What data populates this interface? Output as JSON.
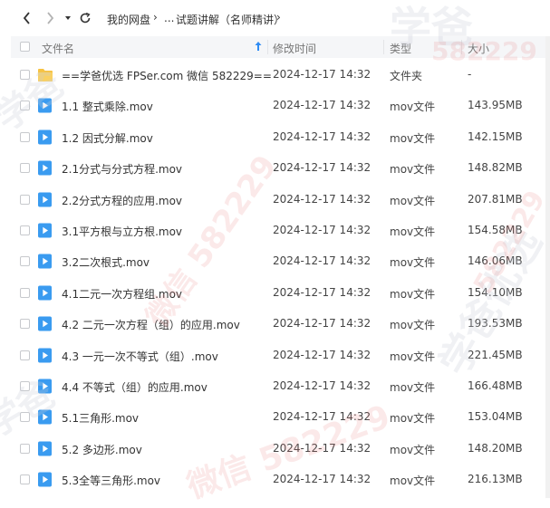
{
  "breadcrumb": {
    "root": "我的网盘",
    "ellipsis": "...",
    "current": "试题讲解（名师精讲）"
  },
  "icons": {
    "back": "chevron-left-icon",
    "forward": "chevron-right-icon",
    "history": "caret-down-icon",
    "refresh": "refresh-icon",
    "sort": "sort-ascending-icon",
    "folder": "folder-icon",
    "video": "video-file-icon"
  },
  "columns": {
    "name": "文件名",
    "modified": "修改时间",
    "type": "类型",
    "size": "大小"
  },
  "files": [
    {
      "name": "==学爸优选 FPSer.com 微信 582229==",
      "modified": "2024-12-17 14:32",
      "type": "文件夹",
      "size": "-",
      "kind": "folder"
    },
    {
      "name": "1.1 整式乘除.mov",
      "modified": "2024-12-17 14:32",
      "type": "mov文件",
      "size": "143.95MB",
      "kind": "video"
    },
    {
      "name": "1.2 因式分解.mov",
      "modified": "2024-12-17 14:32",
      "type": "mov文件",
      "size": "142.15MB",
      "kind": "video"
    },
    {
      "name": "2.1分式与分式方程.mov",
      "modified": "2024-12-17 14:32",
      "type": "mov文件",
      "size": "148.82MB",
      "kind": "video"
    },
    {
      "name": "2.2分式方程的应用.mov",
      "modified": "2024-12-17 14:32",
      "type": "mov文件",
      "size": "207.81MB",
      "kind": "video"
    },
    {
      "name": "3.1平方根与立方根.mov",
      "modified": "2024-12-17 14:32",
      "type": "mov文件",
      "size": "154.58MB",
      "kind": "video"
    },
    {
      "name": "3.2二次根式.mov",
      "modified": "2024-12-17 14:32",
      "type": "mov文件",
      "size": "146.06MB",
      "kind": "video"
    },
    {
      "name": "4.1二元一次方程组.mov",
      "modified": "2024-12-17 14:32",
      "type": "mov文件",
      "size": "154.10MB",
      "kind": "video"
    },
    {
      "name": "4.2 二元一次方程（组）的应用.mov",
      "modified": "2024-12-17 14:32",
      "type": "mov文件",
      "size": "193.53MB",
      "kind": "video"
    },
    {
      "name": "4.3 一元一次不等式（组）.mov",
      "modified": "2024-12-17 14:32",
      "type": "mov文件",
      "size": "221.45MB",
      "kind": "video"
    },
    {
      "name": "4.4 不等式（组）的应用.mov",
      "modified": "2024-12-17 14:32",
      "type": "mov文件",
      "size": "166.48MB",
      "kind": "video"
    },
    {
      "name": "5.1三角形.mov",
      "modified": "2024-12-17 14:32",
      "type": "mov文件",
      "size": "153.04MB",
      "kind": "video"
    },
    {
      "name": "5.2 多边形.mov",
      "modified": "2024-12-17 14:32",
      "type": "mov文件",
      "size": "148.20MB",
      "kind": "video"
    },
    {
      "name": "5.3全等三角形.mov",
      "modified": "2024-12-17 14:32",
      "type": "mov文件",
      "size": "216.13MB",
      "kind": "video"
    }
  ],
  "watermark": {
    "text1": "学爸优选",
    "text2": "微信 582229",
    "text3": "学爸",
    "text4": "582229"
  },
  "colors": {
    "accent": "#2f8cf4",
    "folder": "#f7c342",
    "video": "#3a9bf0"
  }
}
